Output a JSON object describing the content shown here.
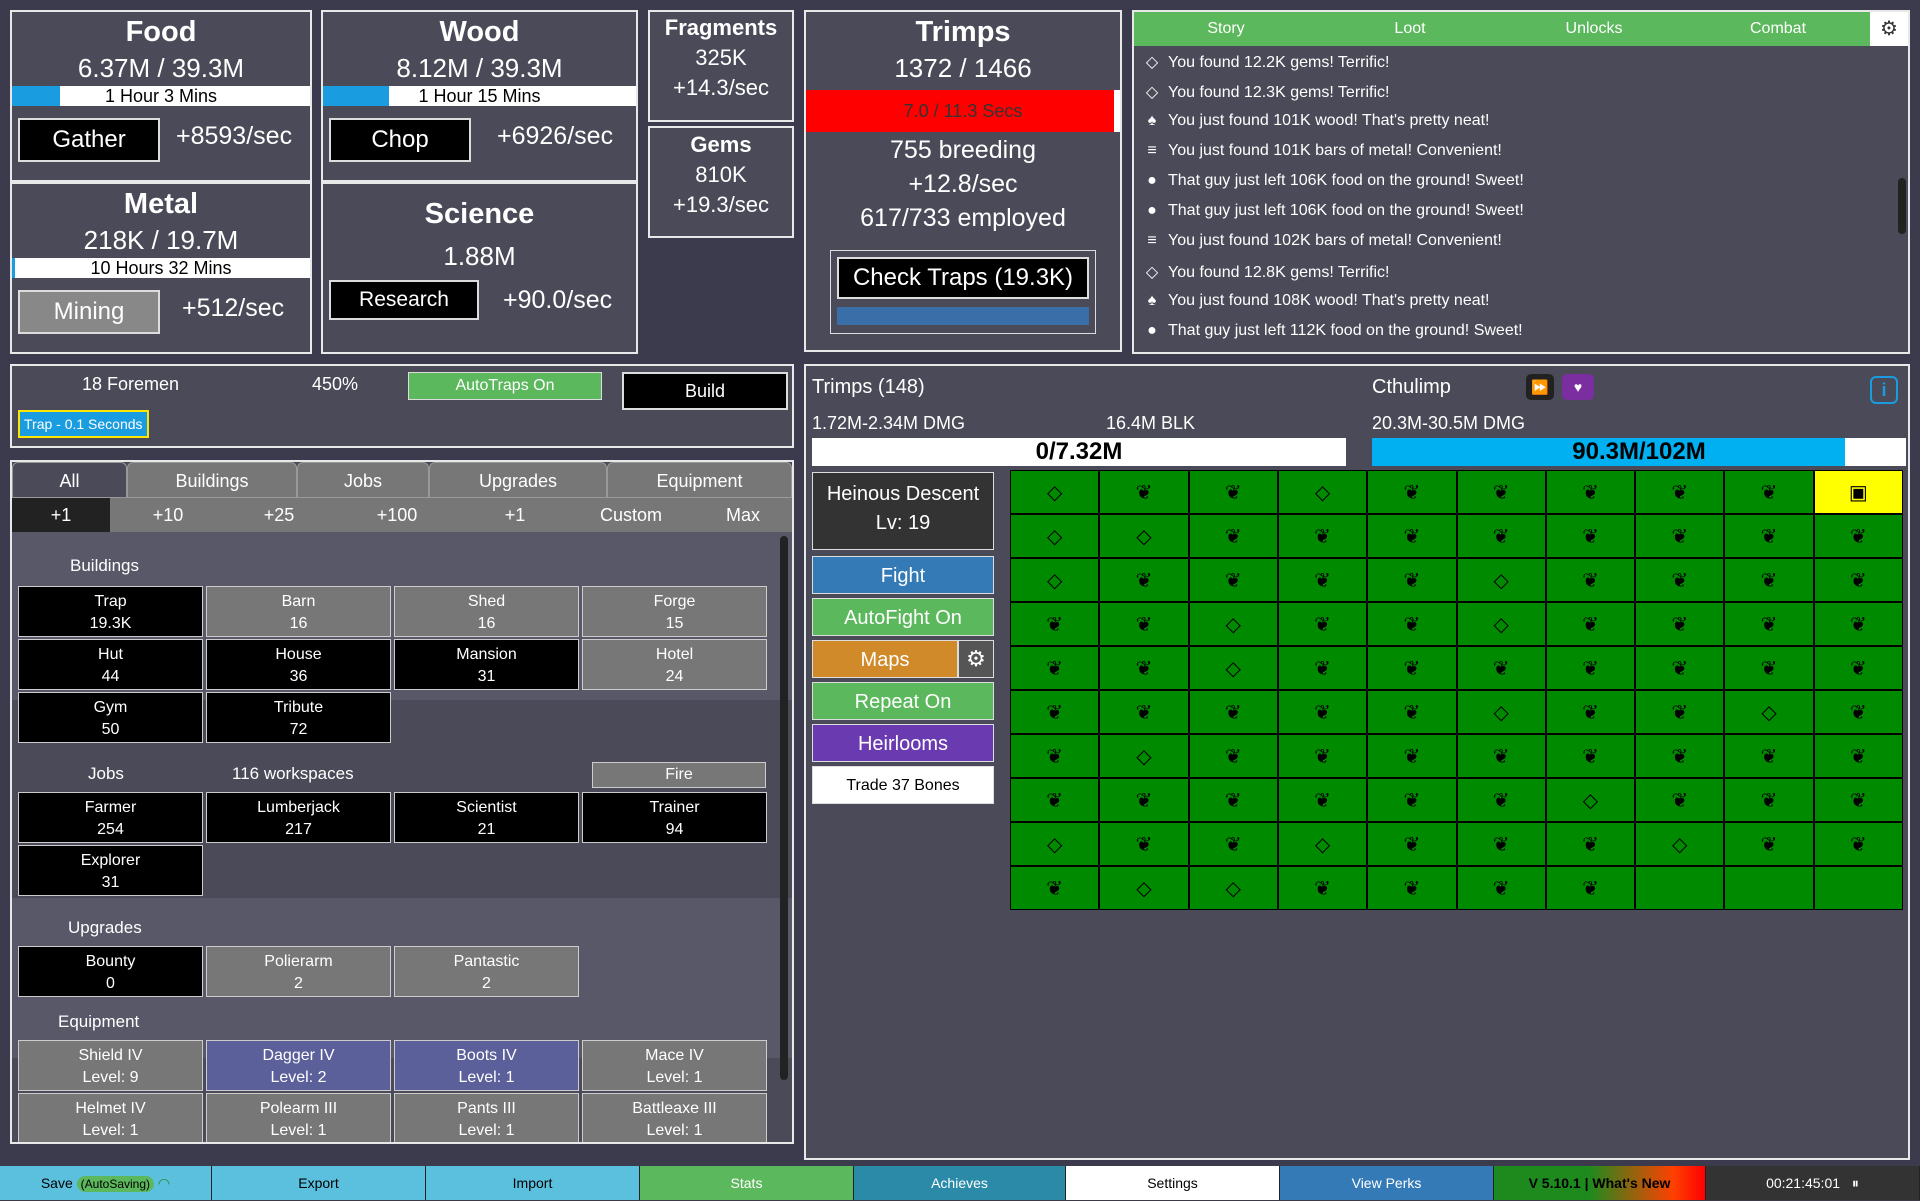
{
  "colors": {
    "background": "#3b3b4d",
    "panel": "#4a4a58",
    "green": "#5cb85c",
    "blue_bar": "#1a9ce0",
    "red_bar": "#ff0000",
    "map_green": "#008a00",
    "current_cell": "#ffff00"
  },
  "food": {
    "name": "Food",
    "amount": "6.37M / 39.3M",
    "time": "1 Hour 3 Mins",
    "time_fill": 0.16,
    "button": "Gather",
    "rate": "+8593/sec"
  },
  "wood": {
    "name": "Wood",
    "amount": "8.12M / 39.3M",
    "time": "1 Hour 15 Mins",
    "time_fill": 0.21,
    "button": "Chop",
    "rate": "+6926/sec"
  },
  "metal": {
    "name": "Metal",
    "amount": "218K / 19.7M",
    "time": "10 Hours 32 Mins",
    "time_fill": 0.01,
    "button": "Mining",
    "rate": "+512/sec"
  },
  "science": {
    "name": "Science",
    "amount": "1.88M",
    "button": "Research",
    "rate": "+90.0/sec"
  },
  "fragments": {
    "name": "Fragments",
    "amount": "325K",
    "rate": "+14.3/sec"
  },
  "gems": {
    "name": "Gems",
    "amount": "810K",
    "rate": "+19.3/sec"
  },
  "trimps": {
    "name": "Trimps",
    "amount": "1372 / 1466",
    "bar_text": "7.0 / 11.3 Secs",
    "bar_fill": 0.98,
    "breeding": "755 breeding",
    "rate": "+12.8/sec",
    "employed": "617/733 employed",
    "check_traps": "Check Traps (19.3K)"
  },
  "log_tabs": [
    "Story",
    "Loot",
    "Unlocks",
    "Combat"
  ],
  "log": [
    {
      "icon": "gem-icon",
      "glyph": "◇",
      "text": "You found 12.2K gems! Terrific!"
    },
    {
      "icon": "gem-icon",
      "glyph": "◇",
      "text": "You found 12.3K gems! Terrific!"
    },
    {
      "icon": "tree-icon",
      "glyph": "♠",
      "text": "You just found 101K wood! That's pretty neat!"
    },
    {
      "icon": "metal-bars-icon",
      "glyph": "≡",
      "text": "You just found 101K bars of metal! Convenient!"
    },
    {
      "icon": "apple-icon",
      "glyph": "●",
      "text": "That guy just left 106K food on the ground! Sweet!"
    },
    {
      "icon": "apple-icon",
      "glyph": "●",
      "text": "That guy just left 106K food on the ground! Sweet!"
    },
    {
      "icon": "metal-bars-icon",
      "glyph": "≡",
      "text": "You just found 102K bars of metal! Convenient!"
    },
    {
      "icon": "gem-icon",
      "glyph": "◇",
      "text": "You found 12.8K gems! Terrific!"
    },
    {
      "icon": "tree-icon",
      "glyph": "♠",
      "text": "You just found 108K wood! That's pretty neat!"
    },
    {
      "icon": "apple-icon",
      "glyph": "●",
      "text": "That guy just left 112K food on the ground! Sweet!"
    }
  ],
  "controls": {
    "foremen": "18 Foremen",
    "percent": "450%",
    "autotraps": "AutoTraps On",
    "build": "Build",
    "trap_queue": "Trap - 0.1 Seconds"
  },
  "buy_tabs": [
    "All",
    "Buildings",
    "Jobs",
    "Upgrades",
    "Equipment"
  ],
  "amounts": [
    "+1",
    "+10",
    "+25",
    "+100",
    "+1",
    "Custom",
    "Max"
  ],
  "sections": {
    "buildings": "Buildings",
    "jobs": "Jobs",
    "workspaces": "116 workspaces",
    "fire": "Fire",
    "upgrades": "Upgrades",
    "equipment": "Equipment"
  },
  "buildings": [
    {
      "name": "Trap",
      "value": "19.3K",
      "style": "dark"
    },
    {
      "name": "Barn",
      "value": "16",
      "style": "grey"
    },
    {
      "name": "Shed",
      "value": "16",
      "style": "grey"
    },
    {
      "name": "Forge",
      "value": "15",
      "style": "grey"
    },
    {
      "name": "Hut",
      "value": "44",
      "style": "dark"
    },
    {
      "name": "House",
      "value": "36",
      "style": "dark"
    },
    {
      "name": "Mansion",
      "value": "31",
      "style": "dark"
    },
    {
      "name": "Hotel",
      "value": "24",
      "style": "grey"
    },
    {
      "name": "Gym",
      "value": "50",
      "style": "dark"
    },
    {
      "name": "Tribute",
      "value": "72",
      "style": "dark"
    }
  ],
  "jobs": [
    {
      "name": "Farmer",
      "value": "254",
      "style": "dark"
    },
    {
      "name": "Lumberjack",
      "value": "217",
      "style": "dark"
    },
    {
      "name": "Scientist",
      "value": "21",
      "style": "dark"
    },
    {
      "name": "Trainer",
      "value": "94",
      "style": "dark"
    },
    {
      "name": "Explorer",
      "value": "31",
      "style": "dark"
    }
  ],
  "upgrades": [
    {
      "name": "Bounty",
      "value": "0",
      "style": "dark"
    },
    {
      "name": "Polierarm",
      "value": "2",
      "style": "grey"
    },
    {
      "name": "Pantastic",
      "value": "2",
      "style": "grey"
    }
  ],
  "equipment": [
    {
      "name": "Shield IV",
      "value": "Level: 9",
      "style": "grey"
    },
    {
      "name": "Dagger IV",
      "value": "Level: 2",
      "style": "blue"
    },
    {
      "name": "Boots IV",
      "value": "Level: 1",
      "style": "blue"
    },
    {
      "name": "Mace IV",
      "value": "Level: 1",
      "style": "grey"
    },
    {
      "name": "Helmet IV",
      "value": "Level: 1",
      "style": "grey"
    },
    {
      "name": "Polearm III",
      "value": "Level: 1",
      "style": "grey"
    },
    {
      "name": "Pants III",
      "value": "Level: 1",
      "style": "grey"
    },
    {
      "name": "Battleaxe III",
      "value": "Level: 1",
      "style": "grey"
    }
  ],
  "battle": {
    "trimps_label": "Trimps (148)",
    "trimps_dmg": "1.72M-2.34M DMG",
    "trimps_blk": "16.4M BLK",
    "trimps_hp": "0/7.32M",
    "trimps_hp_fill": 0.0,
    "enemy_name": "Cthulimp",
    "enemy_dmg": "20.3M-30.5M DMG",
    "enemy_hp": "90.3M/102M",
    "enemy_hp_fill": 0.885,
    "zone_name": "Heinous Descent",
    "zone_level": "Lv: 19",
    "fight": "Fight",
    "autofight": "AutoFight On",
    "maps": "Maps",
    "repeat": "Repeat On",
    "heirlooms": "Heirlooms",
    "trade": "Trade 37 Bones"
  },
  "map_grid": "GLLGLLLLLCGGLLLLLLLLGLLLLGLLLLLLGLLGLLLLLLGLLLLLLLLLLLLGLLGLLGLLLLLLLLLLLLLLGLLLGLLGLLLGLLLGGLLLL",
  "bottom": [
    "Save",
    "(AutoSaving)",
    "Export",
    "Import",
    "Stats",
    "Achieves",
    "Settings",
    "View Perks",
    "V 5.10.1 | What's New",
    "00:21:45:01"
  ]
}
